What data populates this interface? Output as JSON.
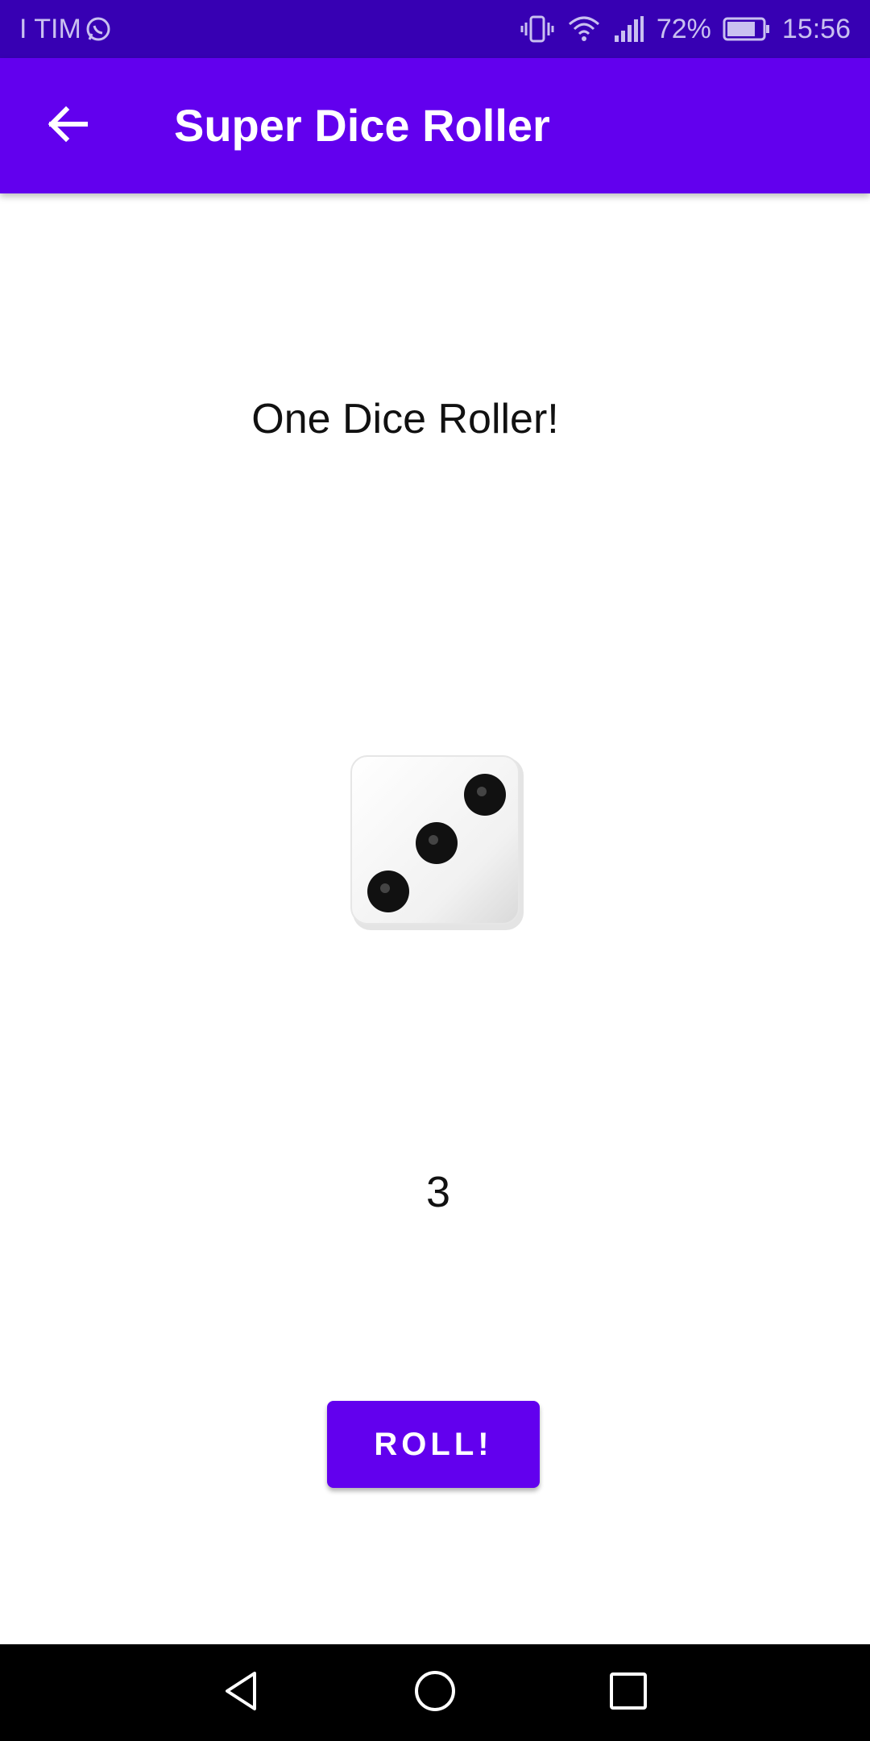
{
  "status_bar": {
    "carrier": "I TIM",
    "battery": "72%",
    "time": "15:56",
    "icons": [
      "whatsapp-icon",
      "vibrate-icon",
      "wifi-icon",
      "signal-icon",
      "battery-icon"
    ]
  },
  "app_bar": {
    "title": "Super Dice Roller",
    "back_icon": "arrow-left-icon",
    "color": "#6200ee"
  },
  "main": {
    "heading": "One Dice Roller!",
    "dice_value": 3,
    "result": "3",
    "roll_label": "ROLL!"
  },
  "nav_bar": {
    "icons": [
      "back-triangle-icon",
      "home-circle-icon",
      "recents-square-icon"
    ]
  },
  "colors": {
    "status_bar": "#3700b3",
    "primary": "#6200ee"
  }
}
